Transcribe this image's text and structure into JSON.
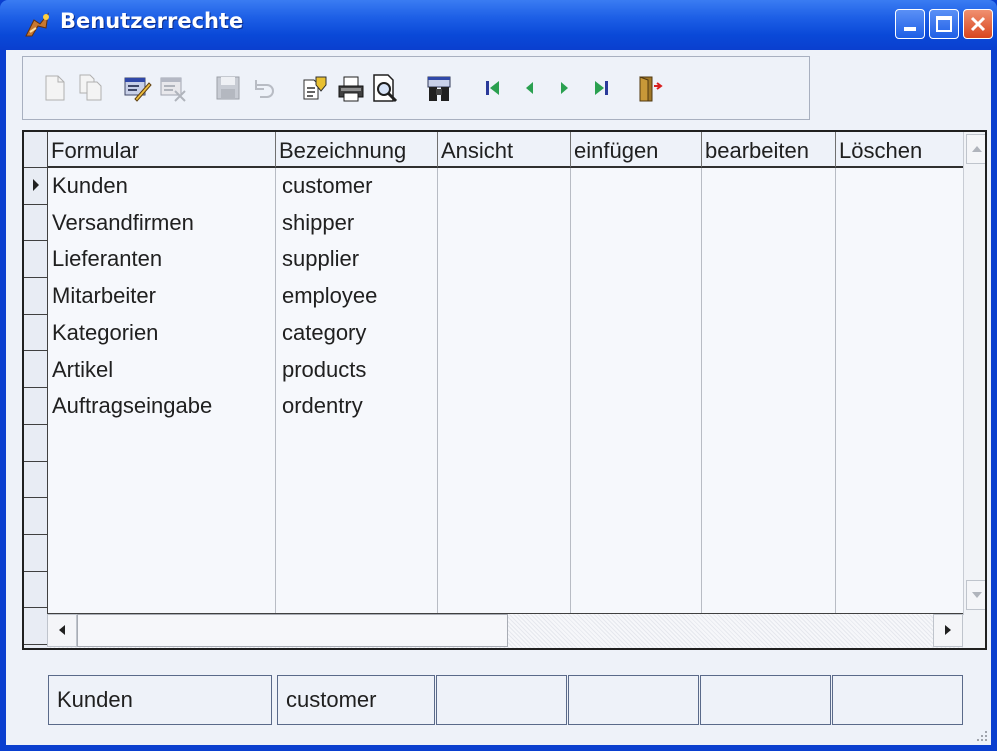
{
  "window": {
    "title": "Benutzerrechte"
  },
  "title_buttons": [
    "minimize",
    "maximize",
    "close"
  ],
  "toolbar": {
    "tools": [
      {
        "name": "new-record",
        "icon": "new-document-icon",
        "enabled": false
      },
      {
        "name": "copy-record",
        "icon": "copy-document-icon",
        "enabled": false
      },
      {
        "name": "edit-record",
        "icon": "edit-form-icon",
        "enabled": true
      },
      {
        "name": "delete-record",
        "icon": "delete-form-icon",
        "enabled": false
      },
      {
        "name": "save-record",
        "icon": "floppy-disk-icon",
        "enabled": false
      },
      {
        "name": "undo",
        "icon": "undo-icon",
        "enabled": false
      },
      {
        "name": "properties",
        "icon": "properties-icon",
        "enabled": true
      },
      {
        "name": "print",
        "icon": "printer-icon",
        "enabled": true
      },
      {
        "name": "print-preview",
        "icon": "print-preview-icon",
        "enabled": true
      },
      {
        "name": "search",
        "icon": "binoculars-icon",
        "enabled": true
      },
      {
        "name": "first-record",
        "icon": "first-record-icon",
        "enabled": true
      },
      {
        "name": "previous-record",
        "icon": "previous-record-icon",
        "enabled": true
      },
      {
        "name": "next-record",
        "icon": "next-record-icon",
        "enabled": true
      },
      {
        "name": "last-record",
        "icon": "last-record-icon",
        "enabled": true
      },
      {
        "name": "exit",
        "icon": "exit-door-icon",
        "enabled": true
      }
    ]
  },
  "grid": {
    "columns": [
      "Formular",
      "Bezeichnung",
      "Ansicht",
      "einfügen",
      "bearbeiten",
      "Löschen"
    ],
    "rows": [
      {
        "formular": "Kunden",
        "bezeichnung": "customer"
      },
      {
        "formular": "Versandfirmen",
        "bezeichnung": "shipper"
      },
      {
        "formular": "Lieferanten",
        "bezeichnung": "supplier"
      },
      {
        "formular": "Mitarbeiter",
        "bezeichnung": "employee"
      },
      {
        "formular": "Kategorien",
        "bezeichnung": "category"
      },
      {
        "formular": "Artikel",
        "bezeichnung": "products"
      },
      {
        "formular": "Auftragseingabe",
        "bezeichnung": "ordentry"
      }
    ],
    "current_row_index": 0
  },
  "detail": {
    "formular": "Kunden",
    "bezeichnung": "customer",
    "ansicht": "",
    "einfuegen": "",
    "bearbeiten": "",
    "loeschen": ""
  },
  "colors": {
    "titlebar": "#0a3fcf",
    "client_background": "#eef2f9",
    "grid_background": "#f6f8fc"
  }
}
